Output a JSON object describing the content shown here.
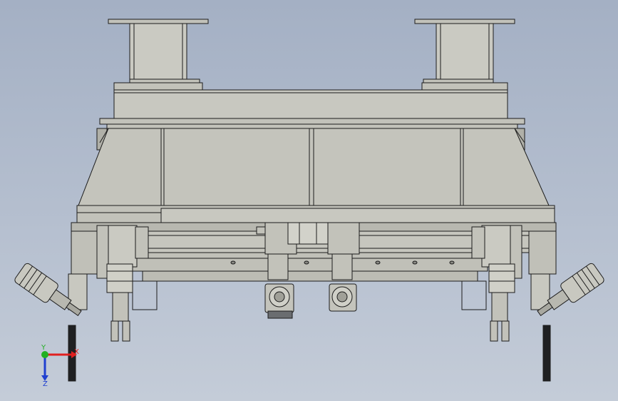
{
  "view": {
    "background_top": "#a4b0c4",
    "background_bottom": "#c4ccd8"
  },
  "colors": {
    "part_fill": "#c2c2ba",
    "part_fill_light": "#d0d0c8",
    "part_fill_dark": "#a8a8a0",
    "edge": "#1c1c1c",
    "shadow": "#55595e",
    "rod": "#1f2022"
  },
  "triad": {
    "x_label": "X",
    "y_label": "Y",
    "z_label": "Z",
    "x_color": "#e02020",
    "y_color": "#22b022",
    "z_color": "#2040d0"
  }
}
